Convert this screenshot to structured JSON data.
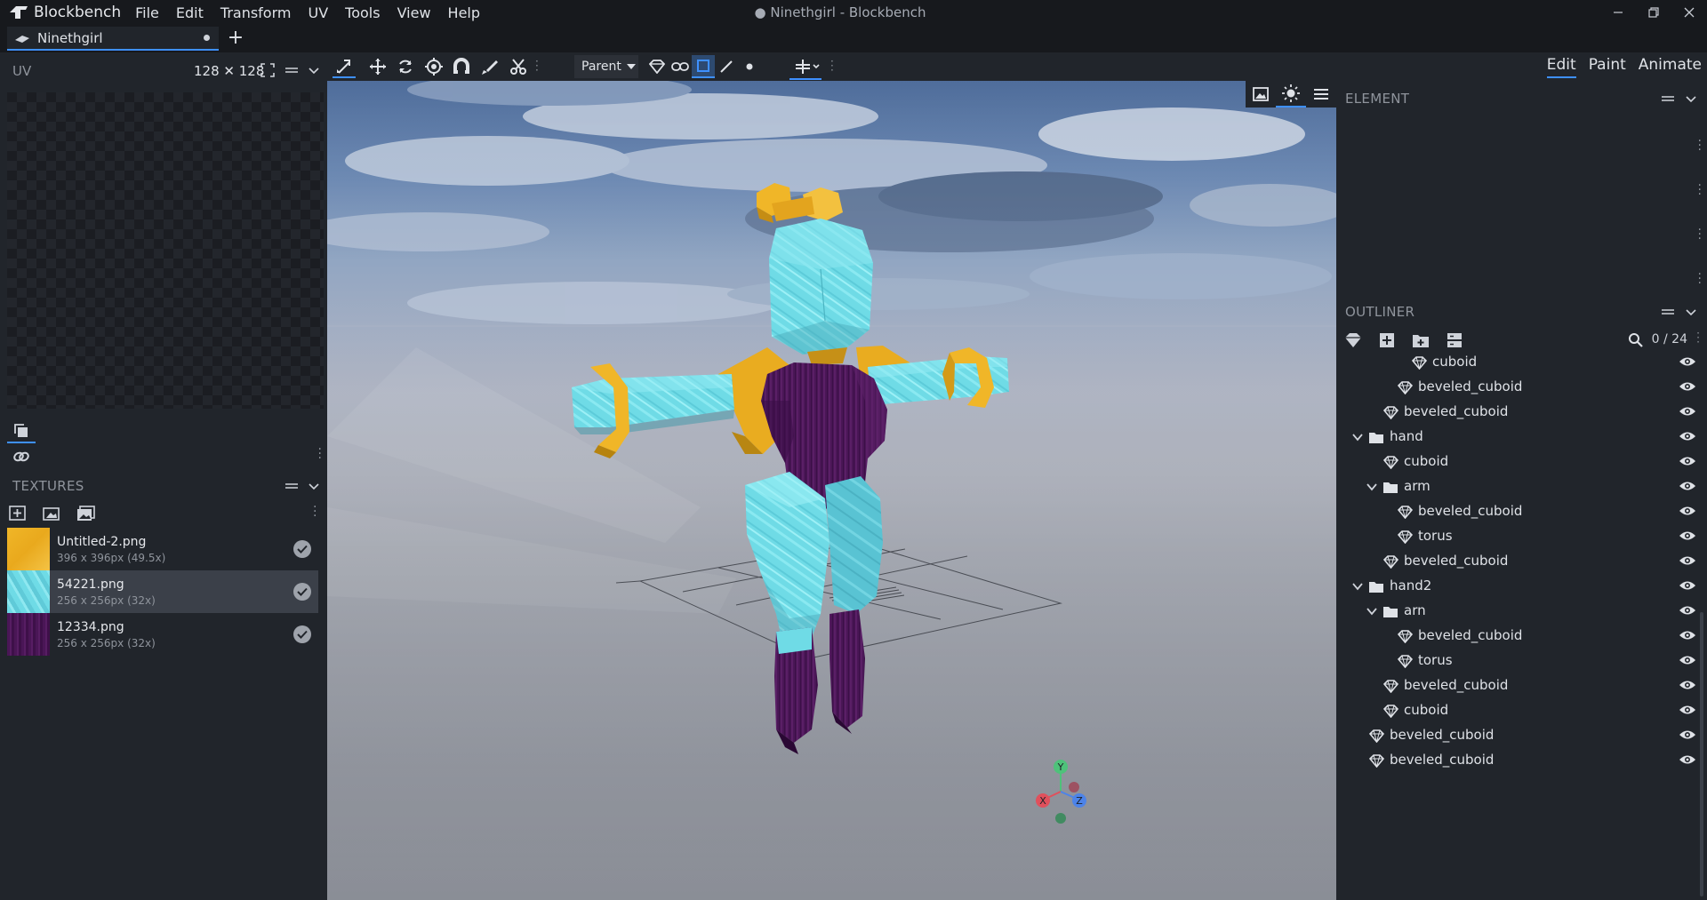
{
  "app": {
    "name": "Blockbench",
    "window_title": "● Ninethgirl - Blockbench",
    "menus": [
      "File",
      "Edit",
      "Transform",
      "UV",
      "Tools",
      "View",
      "Help"
    ]
  },
  "tabs": {
    "project_name": "Ninethgirl",
    "add_label": "+"
  },
  "uv_panel": {
    "title": "UV",
    "size": "128 ✕ 128"
  },
  "textures_panel": {
    "title": "TEXTURES",
    "items": [
      {
        "name": "Untitled-2.png",
        "details": "396 x 396px (49.5x)",
        "color": "#f0b628",
        "selected": false
      },
      {
        "name": "54221.png",
        "details": "256 x 256px (32x)",
        "color": "#6fdbe6",
        "selected": true
      },
      {
        "name": "12334.png",
        "details": "256 x 256px (32x)",
        "color": "#4a1656",
        "selected": false
      }
    ]
  },
  "toolbar": {
    "parent_label": "Parent"
  },
  "modes": {
    "edit": "Edit",
    "paint": "Paint",
    "animate": "Animate",
    "active": "Edit"
  },
  "element_panel": {
    "title": "ELEMENT"
  },
  "outliner": {
    "title": "OUTLINER",
    "count": "0 / 24",
    "rows": [
      {
        "label": "cuboid",
        "type": "cube",
        "depth": 3
      },
      {
        "label": "beveled_cuboid",
        "type": "cube",
        "depth": 2
      },
      {
        "label": "beveled_cuboid",
        "type": "cube",
        "depth": 1
      },
      {
        "label": "hand",
        "type": "group",
        "depth": 0
      },
      {
        "label": "cuboid",
        "type": "cube",
        "depth": 1
      },
      {
        "label": "arm",
        "type": "group",
        "depth": 1
      },
      {
        "label": "beveled_cuboid",
        "type": "cube",
        "depth": 2
      },
      {
        "label": "torus",
        "type": "cube",
        "depth": 2
      },
      {
        "label": "beveled_cuboid",
        "type": "cube",
        "depth": 1
      },
      {
        "label": "hand2",
        "type": "group",
        "depth": 0
      },
      {
        "label": "arn",
        "type": "group",
        "depth": 1
      },
      {
        "label": "beveled_cuboid",
        "type": "cube",
        "depth": 2
      },
      {
        "label": "torus",
        "type": "cube",
        "depth": 2
      },
      {
        "label": "beveled_cuboid",
        "type": "cube",
        "depth": 1
      },
      {
        "label": "cuboid",
        "type": "cube",
        "depth": 1
      },
      {
        "label": "beveled_cuboid",
        "type": "cube",
        "depth": 0
      },
      {
        "label": "beveled_cuboid",
        "type": "cube",
        "depth": 0
      }
    ]
  },
  "axis_gizmo": {
    "x": "X",
    "y": "Y",
    "z": "Z"
  },
  "colors": {
    "accent": "#3e90ff",
    "panel_bg": "#21252b",
    "titlebar_bg": "#17191d",
    "model_cyan": "#6fdbe6",
    "model_gold": "#f0b628",
    "model_purple": "#4a1656"
  }
}
